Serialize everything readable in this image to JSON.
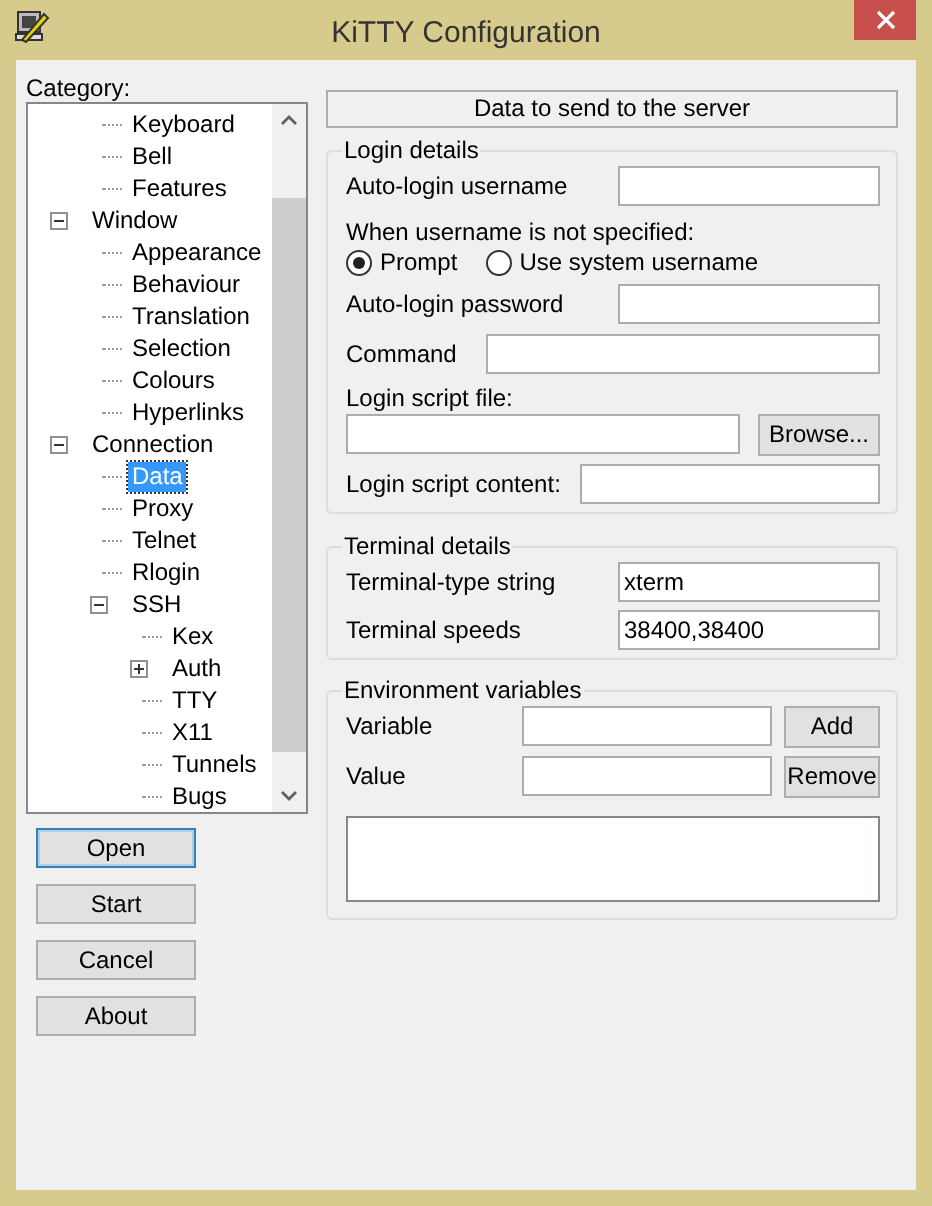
{
  "window": {
    "title": "KiTTY Configuration"
  },
  "category": {
    "label": "Category:",
    "tree": [
      {
        "children": [
          {
            "label": "Keyboard",
            "selected": false
          },
          {
            "label": "Bell",
            "selected": false
          },
          {
            "label": "Features",
            "selected": false
          }
        ]
      },
      {
        "label": "Window",
        "selected": false,
        "expanded": true,
        "children": [
          {
            "label": "Appearance",
            "selected": false
          },
          {
            "label": "Behaviour",
            "selected": false
          },
          {
            "label": "Translation",
            "selected": false
          },
          {
            "label": "Selection",
            "selected": false
          },
          {
            "label": "Colours",
            "selected": false
          },
          {
            "label": "Hyperlinks",
            "selected": false
          }
        ]
      },
      {
        "label": "Connection",
        "selected": false,
        "expanded": true,
        "children": [
          {
            "label": "Data",
            "selected": true
          },
          {
            "label": "Proxy",
            "selected": false
          },
          {
            "label": "Telnet",
            "selected": false
          },
          {
            "label": "Rlogin",
            "selected": false
          },
          {
            "label": "SSH",
            "selected": false,
            "expanded": true,
            "children": [
              {
                "label": "Kex",
                "selected": false
              },
              {
                "label": "Auth",
                "selected": false,
                "expanded": false
              },
              {
                "label": "TTY",
                "selected": false
              },
              {
                "label": "X11",
                "selected": false
              },
              {
                "label": "Tunnels",
                "selected": false
              },
              {
                "label": "Bugs",
                "selected": false
              }
            ]
          }
        ]
      }
    ]
  },
  "buttons": [
    {
      "label": "Open",
      "default": true
    },
    {
      "label": "Start",
      "default": false
    },
    {
      "label": "Cancel",
      "default": false
    },
    {
      "label": "About",
      "default": false
    }
  ],
  "panel": {
    "header": "Data to send to the server",
    "login": {
      "title": "Login details",
      "username_label": "Auto-login username",
      "when_label": "When username is not specified:",
      "options": [
        {
          "label": "Prompt",
          "selected": true
        },
        {
          "label": "Use system username",
          "selected": false
        }
      ],
      "password_label": "Auto-login password",
      "command_label": "Command",
      "script_file_label": "Login script file:",
      "browse": "Browse...",
      "script_content_label": "Login script content:"
    },
    "terminal": {
      "title": "Terminal details",
      "type_label": "Terminal-type string",
      "type_value": "xterm",
      "speeds_label": "Terminal speeds",
      "speeds_value": "38400,38400"
    },
    "environment": {
      "title": "Environment variables",
      "variable_label": "Variable",
      "value_label": "Value",
      "add": "Add",
      "remove": "Remove"
    }
  }
}
